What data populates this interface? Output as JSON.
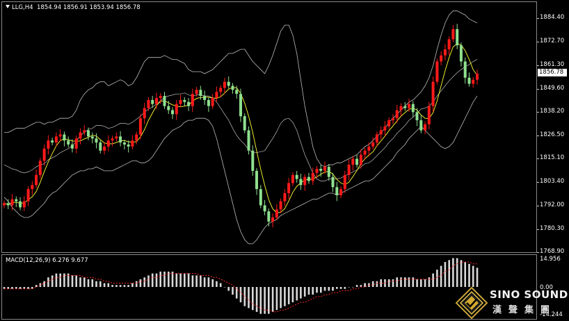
{
  "header": {
    "symbol": "LLG,H4",
    "ohlc": "1854.94 1856.91 1853.94 1856.78"
  },
  "price_tag": "1856.78",
  "macd_label": "MACD(12,26,9) 6.276 9.677",
  "logo": {
    "name": "SINO SOUND",
    "subtitle": "漢聲集團"
  },
  "colors": {
    "background": "#000000",
    "bull_candle": "#ff1a1a",
    "bear_candle": "#8fe08f",
    "bollinger": "#bdbdbd",
    "ma_fast": "#ffff33",
    "macd_hist": "#d9d9d9",
    "macd_signal": "#ff2a2a"
  },
  "chart_data": [
    {
      "type": "candlestick",
      "name": "price",
      "y_ticks": [
        "1884.40",
        "1872.70",
        "1861.30",
        "1849.60",
        "1838.20",
        "1826.50",
        "1815.10",
        "1803.40",
        "1792.00",
        "1780.30",
        "1768.90"
      ],
      "y_tick_values": [
        1884.4,
        1872.7,
        1861.3,
        1849.6,
        1838.2,
        1826.5,
        1815.1,
        1803.4,
        1792.0,
        1780.3,
        1768.9
      ],
      "ylim": [
        1767.5,
        1891.0
      ],
      "last_price": 1856.78,
      "closes": [
        1792,
        1791,
        1794,
        1793,
        1790,
        1793,
        1799,
        1801,
        1806,
        1813,
        1819,
        1823,
        1822,
        1825,
        1826,
        1823,
        1821,
        1819,
        1824,
        1827,
        1828,
        1825,
        1824,
        1822,
        1818,
        1820,
        1823,
        1824,
        1825,
        1822,
        1821,
        1820,
        1823,
        1826,
        1834,
        1839,
        1843,
        1841,
        1844,
        1845,
        1840,
        1838,
        1836,
        1841,
        1843,
        1842,
        1840,
        1846,
        1848,
        1845,
        1843,
        1840,
        1844,
        1847,
        1849,
        1852,
        1850,
        1848,
        1846,
        1835,
        1828,
        1818,
        1808,
        1799,
        1791,
        1788,
        1783,
        1785,
        1789,
        1793,
        1797,
        1802,
        1806,
        1804,
        1801,
        1805,
        1803,
        1807,
        1809,
        1808,
        1810,
        1805,
        1800,
        1796,
        1799,
        1806,
        1811,
        1814,
        1811,
        1816,
        1818,
        1820,
        1822,
        1826,
        1828,
        1830,
        1833,
        1834,
        1838,
        1840,
        1839,
        1841,
        1837,
        1833,
        1828,
        1831,
        1840,
        1852,
        1862,
        1865,
        1868,
        1873,
        1878,
        1870,
        1862,
        1854,
        1851,
        1853,
        1856
      ],
      "bollinger_upper": [
        1827,
        1827,
        1828,
        1829,
        1829,
        1829,
        1830,
        1831,
        1832,
        1832,
        1831,
        1832,
        1832,
        1833,
        1834,
        1834,
        1834,
        1835,
        1838,
        1843,
        1846,
        1848,
        1849,
        1851,
        1852,
        1852,
        1850,
        1851,
        1852,
        1853,
        1852,
        1850,
        1851,
        1854,
        1858,
        1862,
        1864,
        1864,
        1864,
        1864,
        1865,
        1864,
        1863,
        1863,
        1862,
        1861,
        1858,
        1857,
        1857,
        1857,
        1856,
        1857,
        1858,
        1860,
        1862,
        1864,
        1866,
        1866,
        1867,
        1868,
        1868,
        1865,
        1862,
        1860,
        1858,
        1856,
        1860,
        1865,
        1871,
        1877,
        1880,
        1880,
        1875,
        1866,
        1853,
        1840,
        1830,
        1820,
        1814,
        1811,
        1810,
        1811,
        1811,
        1812,
        1812,
        1813,
        1814,
        1815,
        1816,
        1818,
        1820,
        1821,
        1823,
        1825,
        1827,
        1829,
        1832,
        1834,
        1836,
        1838,
        1840,
        1842,
        1843,
        1845,
        1847,
        1850,
        1854,
        1860,
        1868,
        1875,
        1881,
        1885,
        1887,
        1887,
        1886,
        1885,
        1883,
        1882,
        1881
      ],
      "bollinger_lower": [
        1795,
        1793,
        1790,
        1788,
        1786,
        1785,
        1785,
        1786,
        1788,
        1790,
        1792,
        1795,
        1797,
        1798,
        1800,
        1802,
        1804,
        1806,
        1807,
        1808,
        1808,
        1809,
        1809,
        1810,
        1809,
        1808,
        1808,
        1808,
        1809,
        1810,
        1811,
        1812,
        1813,
        1813,
        1812,
        1812,
        1813,
        1815,
        1818,
        1821,
        1824,
        1826,
        1828,
        1829,
        1830,
        1832,
        1833,
        1833,
        1834,
        1834,
        1834,
        1833,
        1830,
        1824,
        1816,
        1808,
        1800,
        1792,
        1784,
        1778,
        1774,
        1772,
        1772,
        1774,
        1777,
        1780,
        1782,
        1783,
        1784,
        1786,
        1787,
        1788,
        1789,
        1790,
        1791,
        1792,
        1793,
        1794,
        1794,
        1795,
        1796,
        1797,
        1797,
        1796,
        1797,
        1798,
        1799,
        1800,
        1801,
        1802,
        1803,
        1803,
        1804,
        1806,
        1808,
        1810,
        1812,
        1814,
        1817,
        1819,
        1821,
        1824,
        1826,
        1828,
        1830,
        1828,
        1826,
        1824,
        1822,
        1820,
        1819,
        1820,
        1822,
        1826,
        1830,
        1834,
        1838,
        1842,
        1845
      ]
    },
    {
      "type": "bar",
      "name": "macd",
      "y_ticks": [
        "14.956",
        "0.00",
        "-14.244"
      ],
      "y_tick_values": [
        14.956,
        0,
        -14.244
      ],
      "ylim": [
        -17,
        17
      ],
      "histogram": [
        -1,
        -1,
        -1,
        -1,
        -1,
        -1,
        -1,
        -1,
        1,
        2,
        3,
        5,
        6,
        7,
        7,
        7,
        7,
        6,
        6,
        5,
        5,
        4,
        4,
        3,
        3,
        2,
        2,
        1,
        1,
        1,
        1,
        1,
        2,
        3,
        4,
        5,
        6,
        7,
        7,
        8,
        8,
        8,
        8,
        7,
        7,
        7,
        7,
        6,
        6,
        6,
        5,
        5,
        4,
        3,
        2,
        0,
        -2,
        -4,
        -6,
        -8,
        -10,
        -11,
        -12,
        -13,
        -14,
        -14,
        -14,
        -13,
        -12,
        -11,
        -10,
        -9,
        -8,
        -7,
        -6,
        -5,
        -4,
        -4,
        -3,
        -3,
        -2,
        -2,
        -2,
        -1,
        -1,
        -1,
        0,
        0,
        1,
        1,
        2,
        2,
        3,
        3,
        4,
        4,
        4,
        4,
        5,
        5,
        5,
        5,
        5,
        4,
        4,
        4,
        5,
        7,
        9,
        11,
        13,
        14,
        15,
        15,
        14,
        13,
        12,
        11,
        10
      ],
      "signal": [
        -1,
        -1,
        -1,
        -1,
        -1,
        -1,
        -1,
        -1,
        0,
        1,
        2,
        3,
        4,
        5,
        5,
        6,
        6,
        6,
        6,
        6,
        5,
        5,
        5,
        4,
        4,
        3,
        3,
        2,
        2,
        2,
        2,
        2,
        2,
        2,
        3,
        3,
        4,
        5,
        5,
        6,
        6,
        7,
        7,
        7,
        7,
        7,
        7,
        7,
        7,
        6,
        6,
        6,
        5,
        5,
        4,
        3,
        2,
        1,
        -1,
        -3,
        -5,
        -7,
        -9,
        -10,
        -11,
        -12,
        -12,
        -13,
        -13,
        -12,
        -12,
        -11,
        -10,
        -9,
        -8,
        -8,
        -7,
        -6,
        -5,
        -5,
        -4,
        -4,
        -3,
        -3,
        -2,
        -2,
        -2,
        -1,
        -1,
        0,
        0,
        1,
        1,
        2,
        2,
        2,
        3,
        3,
        3,
        4,
        4,
        4,
        4,
        4,
        4,
        4,
        4,
        4,
        5,
        6,
        8,
        9,
        11,
        12,
        13,
        13,
        13,
        12,
        12
      ]
    }
  ]
}
